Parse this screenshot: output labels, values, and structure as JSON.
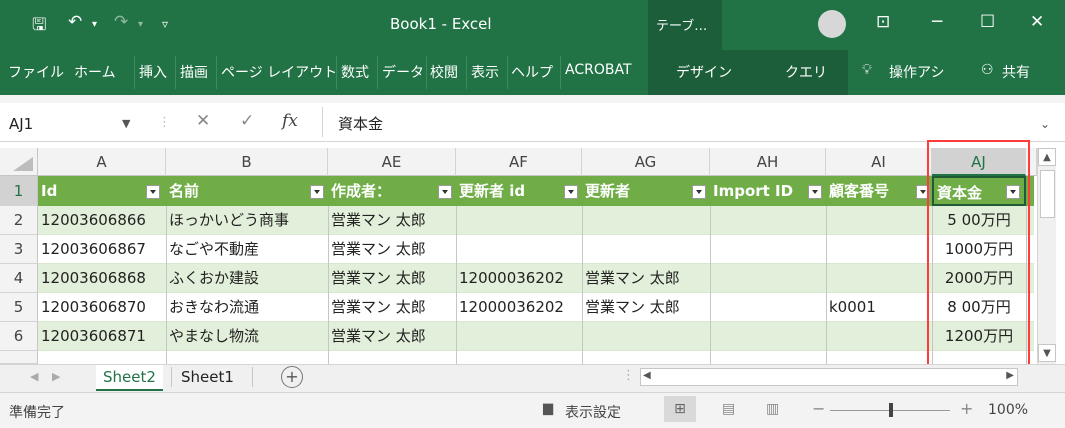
{
  "titlebar": {
    "title": "Book1 - Excel",
    "context_tab": "テーブ…"
  },
  "ribbon": {
    "tabs": [
      "ファイル",
      "ホーム",
      "挿入",
      "描画",
      "ページ レイアウト",
      "数式",
      "データ",
      "校閲",
      "表示",
      "ヘルプ",
      "ACROBAT",
      "デザイン",
      "クエリ"
    ],
    "tell_me": "操作アシ",
    "share": "共有"
  },
  "formula_bar": {
    "name_box": "AJ1",
    "formula": "資本金"
  },
  "columns": [
    "A",
    "B",
    "AE",
    "AF",
    "AG",
    "AH",
    "AI",
    "AJ"
  ],
  "row_numbers": [
    "1",
    "2",
    "3",
    "4",
    "5",
    "6"
  ],
  "table_headers": [
    "Id",
    "名前",
    "作成者：",
    "更新者 id",
    "更新者",
    "Import ID",
    "顧客番号",
    "資本金"
  ],
  "rows": [
    [
      "12003606866",
      "ほっかいどう商事",
      "営業マン 太郎",
      "",
      "",
      "",
      "",
      "5 00万円"
    ],
    [
      "12003606867",
      "なごや不動産",
      "営業マン 太郎",
      "",
      "",
      "",
      "",
      "1000万円"
    ],
    [
      "12003606868",
      "ふくおか建設",
      "営業マン 太郎",
      "12000036202",
      "営業マン 太郎",
      "",
      "",
      "2000万円"
    ],
    [
      "12003606870",
      "おきなわ流通",
      "営業マン 太郎",
      "12000036202",
      "営業マン 太郎",
      "",
      "k0001",
      "8 00万円"
    ],
    [
      "12003606871",
      "やまなし物流",
      "営業マン 太郎",
      "",
      "",
      "",
      "",
      "1200万円"
    ]
  ],
  "sheets": [
    "Sheet2",
    "Sheet1"
  ],
  "status": {
    "ready": "準備完了",
    "display_settings": "表示設定",
    "zoom": "100%"
  },
  "colors": {
    "excel_green": "#217346",
    "table_header": "#70ad47",
    "band": "#e2efda",
    "highlight_box": "#ff3b3b"
  }
}
